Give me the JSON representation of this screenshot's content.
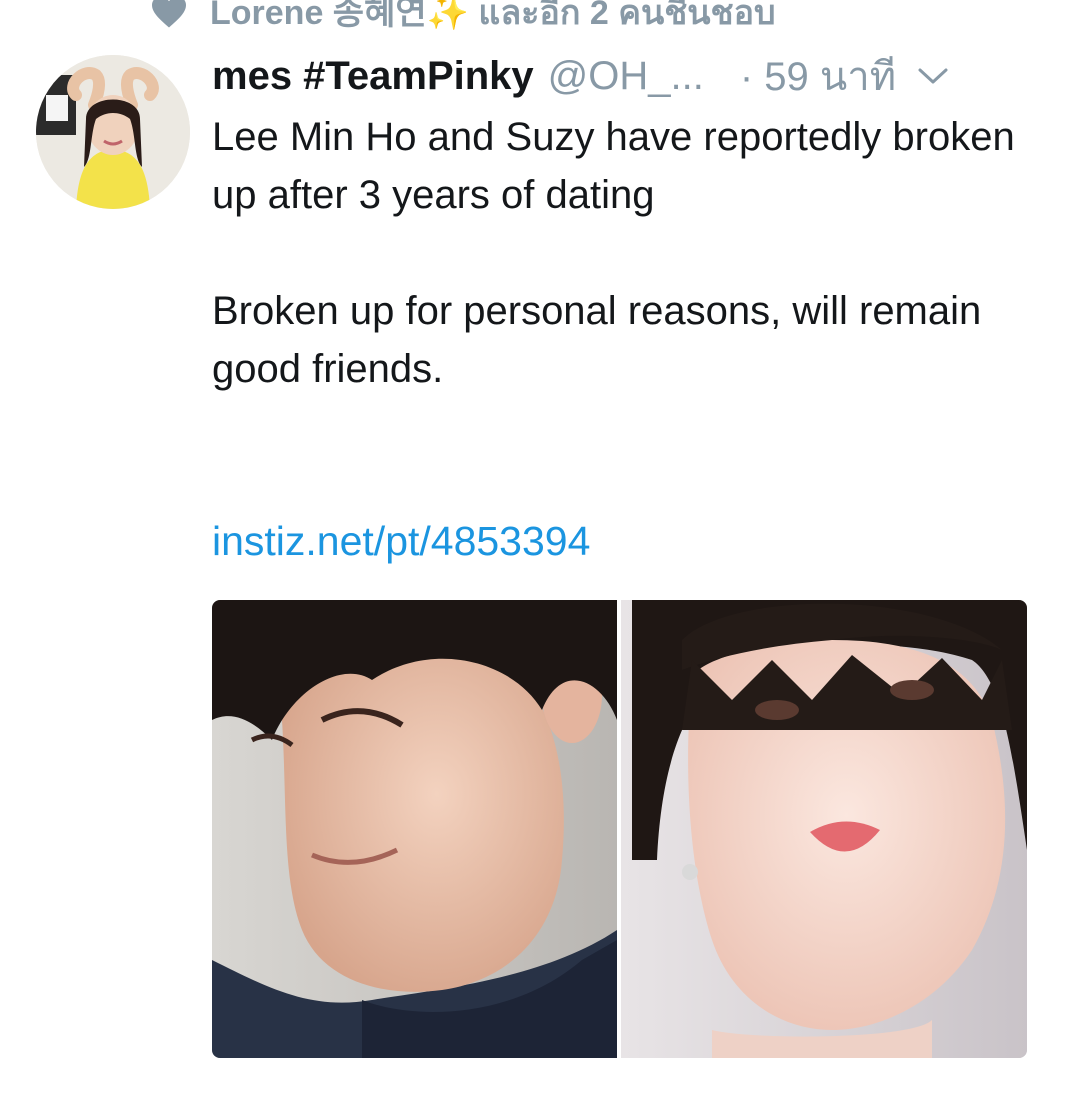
{
  "social_context": {
    "icon": "heart-icon",
    "text": "Lorene 송혜연✨ และอีก 2 คนชื่นชอบ"
  },
  "tweet": {
    "avatar": "user-avatar",
    "display_name": "mes #TeamPinky",
    "handle": "@OH_...",
    "timestamp": "· 59 นาที",
    "menu_icon": "chevron-down-icon",
    "text_line_1": "Lee Min Ho and Suzy have reportedly broken up after 3 years of dating",
    "text_line_2": "Broken up for personal reasons, will remain good friends.",
    "link": "instiz.net/pt/4853394",
    "media": "photo-collage"
  },
  "colors": {
    "text_primary": "#14171a",
    "text_secondary": "#8899a6",
    "link": "#1b95e0",
    "background": "#ffffff"
  }
}
